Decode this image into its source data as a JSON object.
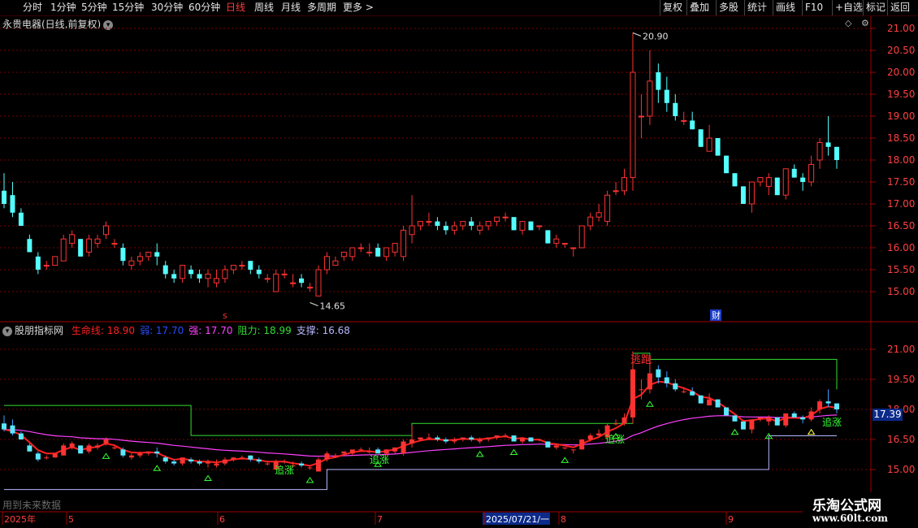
{
  "toolbar": {
    "left": [
      "分时",
      "1分钟",
      "5分钟",
      "15分钟",
      "30分钟",
      "60分钟",
      "日线",
      "周线",
      "月线",
      "多周期",
      "更多"
    ],
    "active_index": 6,
    "more_arrow": ">",
    "right": [
      "复权",
      "叠加",
      "多股",
      "统计",
      "画线",
      "F10",
      "+自选",
      "标记",
      "返回"
    ]
  },
  "stock": {
    "title": "永贵电器(日线,前复权)",
    "dropdown": "▾"
  },
  "corner": {
    "diamond": "◇",
    "gear": "⚙"
  },
  "indicator": {
    "name": "股朋指标网",
    "params": [
      {
        "label": "生命线: 18.90",
        "color": "#ff2020"
      },
      {
        "label": "弱: 17.70",
        "color": "#2a4bff"
      },
      {
        "label": "强: 17.70",
        "color": "#ff40ff"
      },
      {
        "label": "阻力: 18.99",
        "color": "#33dd33"
      },
      {
        "label": "支撑: 16.68",
        "color": "#b8b8ff"
      }
    ]
  },
  "axis": {
    "main_ticks": [
      "21.00",
      "20.50",
      "20.00",
      "19.50",
      "19.00",
      "18.50",
      "18.00",
      "17.50",
      "17.00",
      "16.50",
      "16.00",
      "15.50",
      "15.00"
    ],
    "ind_ticks": [
      "21.00",
      "19.50",
      "18.00",
      "16.50",
      "15.00"
    ]
  },
  "annotations": {
    "high": "20.90",
    "low": "14.65",
    "marker_s": "s",
    "marker_cai": "财",
    "signal_escape": "逃跑",
    "signal_chase": "追涨",
    "price_tag": "17.39"
  },
  "date_axis": {
    "labels": [
      "2025年",
      "5",
      "6",
      "7",
      "2025/07/21/一",
      "8",
      "9"
    ]
  },
  "bottom_note": "用到未来数据",
  "logo": {
    "line1": "乐淘公式网",
    "line2": "www.60lt.com"
  },
  "colors": {
    "up": "#ff3232",
    "down": "#54ffff",
    "bg": "#000000",
    "grid": "#7a0000"
  },
  "chart_data": {
    "type": "candlestick",
    "title": "永贵电器(日线,前复权)",
    "ylim": [
      14.6,
      21.1
    ],
    "high_label": 20.9,
    "low_label": 14.65,
    "last_close": 18.0,
    "ohlc": [
      [
        17.3,
        17.7,
        16.9,
        17.0
      ],
      [
        17.2,
        17.5,
        16.7,
        16.8
      ],
      [
        16.8,
        16.9,
        16.5,
        16.5
      ],
      [
        16.2,
        16.3,
        15.9,
        15.9
      ],
      [
        15.8,
        15.9,
        15.4,
        15.5
      ],
      [
        15.6,
        15.7,
        15.5,
        15.6
      ],
      [
        15.6,
        15.8,
        15.6,
        15.8
      ],
      [
        15.7,
        16.3,
        15.7,
        16.2
      ],
      [
        16.1,
        16.4,
        16.0,
        16.3
      ],
      [
        16.2,
        16.2,
        15.8,
        15.8
      ],
      [
        15.9,
        16.3,
        15.8,
        16.2
      ],
      [
        16.1,
        16.3,
        16.0,
        16.2
      ],
      [
        16.3,
        16.6,
        16.2,
        16.5
      ],
      [
        16.1,
        16.2,
        16.0,
        16.1
      ],
      [
        16.0,
        16.1,
        15.6,
        15.7
      ],
      [
        15.6,
        15.8,
        15.5,
        15.7
      ],
      [
        15.7,
        15.9,
        15.6,
        15.8
      ],
      [
        15.8,
        15.9,
        15.7,
        15.9
      ],
      [
        15.9,
        16.1,
        15.6,
        15.8
      ],
      [
        15.6,
        15.7,
        15.3,
        15.4
      ],
      [
        15.4,
        15.5,
        15.2,
        15.3
      ],
      [
        15.3,
        15.6,
        15.2,
        15.6
      ],
      [
        15.5,
        15.6,
        15.3,
        15.4
      ],
      [
        15.4,
        15.5,
        15.2,
        15.3
      ],
      [
        15.3,
        15.5,
        15.1,
        15.4
      ],
      [
        15.2,
        15.5,
        15.1,
        15.3
      ],
      [
        15.3,
        15.6,
        15.2,
        15.5
      ],
      [
        15.5,
        15.6,
        15.4,
        15.6
      ],
      [
        15.6,
        15.7,
        15.5,
        15.6
      ],
      [
        15.7,
        15.7,
        15.4,
        15.5
      ],
      [
        15.5,
        15.6,
        15.3,
        15.4
      ],
      [
        15.3,
        15.4,
        15.2,
        15.3
      ],
      [
        15.0,
        15.5,
        15.0,
        15.4
      ],
      [
        15.4,
        15.5,
        15.3,
        15.4
      ],
      [
        15.2,
        15.4,
        15.1,
        15.2
      ],
      [
        15.3,
        15.4,
        15.1,
        15.2
      ],
      [
        15.1,
        15.2,
        15.0,
        15.1
      ],
      [
        14.9,
        15.6,
        14.9,
        15.5
      ],
      [
        15.5,
        15.9,
        15.4,
        15.8
      ],
      [
        15.6,
        15.8,
        15.6,
        15.7
      ],
      [
        15.8,
        15.9,
        15.7,
        15.9
      ],
      [
        15.8,
        16.0,
        15.7,
        16.0
      ],
      [
        16.0,
        16.1,
        15.9,
        16.0
      ],
      [
        15.9,
        16.1,
        15.8,
        15.9
      ],
      [
        16.0,
        16.1,
        15.8,
        15.8
      ],
      [
        15.8,
        16.0,
        15.7,
        16.0
      ],
      [
        15.9,
        16.1,
        15.8,
        16.1
      ],
      [
        15.8,
        16.5,
        15.7,
        16.4
      ],
      [
        16.3,
        17.2,
        16.1,
        16.5
      ],
      [
        16.5,
        16.6,
        16.4,
        16.6
      ],
      [
        16.6,
        16.8,
        16.5,
        16.6
      ],
      [
        16.6,
        16.7,
        16.4,
        16.5
      ],
      [
        16.5,
        16.6,
        16.3,
        16.4
      ],
      [
        16.4,
        16.6,
        16.3,
        16.5
      ],
      [
        16.5,
        16.6,
        16.4,
        16.6
      ],
      [
        16.6,
        16.7,
        16.4,
        16.5
      ],
      [
        16.4,
        16.6,
        16.3,
        16.5
      ],
      [
        16.5,
        16.6,
        16.4,
        16.6
      ],
      [
        16.6,
        16.7,
        16.5,
        16.7
      ],
      [
        16.7,
        16.8,
        16.6,
        16.7
      ],
      [
        16.7,
        16.7,
        16.4,
        16.4
      ],
      [
        16.4,
        16.6,
        16.3,
        16.6
      ],
      [
        16.6,
        16.6,
        16.4,
        16.4
      ],
      [
        16.5,
        16.5,
        16.4,
        16.5
      ],
      [
        16.4,
        16.4,
        16.1,
        16.1
      ],
      [
        16.1,
        16.3,
        16.0,
        16.2
      ],
      [
        16.1,
        16.1,
        16.0,
        16.1
      ],
      [
        16.0,
        16.0,
        15.8,
        16.0
      ],
      [
        16.0,
        16.5,
        16.0,
        16.5
      ],
      [
        16.5,
        16.8,
        16.4,
        16.7
      ],
      [
        16.7,
        17.0,
        16.6,
        16.8
      ],
      [
        16.6,
        17.3,
        16.5,
        17.2
      ],
      [
        17.3,
        17.5,
        17.2,
        17.3
      ],
      [
        17.3,
        17.8,
        17.2,
        17.6
      ],
      [
        17.6,
        20.9,
        17.3,
        20.0
      ],
      [
        19.0,
        19.5,
        18.5,
        19.0
      ],
      [
        19.0,
        20.5,
        18.8,
        19.8
      ],
      [
        20.0,
        20.2,
        19.3,
        19.6
      ],
      [
        19.6,
        19.9,
        19.1,
        19.3
      ],
      [
        19.3,
        19.5,
        18.9,
        19.0
      ],
      [
        18.9,
        19.1,
        18.8,
        18.9
      ],
      [
        18.9,
        19.1,
        18.7,
        18.7
      ],
      [
        18.7,
        18.7,
        18.3,
        18.3
      ],
      [
        18.2,
        18.8,
        18.2,
        18.5
      ],
      [
        18.5,
        18.5,
        18.1,
        18.1
      ],
      [
        18.1,
        18.1,
        17.7,
        17.7
      ],
      [
        17.7,
        17.7,
        17.4,
        17.4
      ],
      [
        17.4,
        17.4,
        17.0,
        17.0
      ],
      [
        17.0,
        17.5,
        16.8,
        17.5
      ],
      [
        17.5,
        17.6,
        17.4,
        17.6
      ],
      [
        17.4,
        17.7,
        17.2,
        17.6
      ],
      [
        17.6,
        17.6,
        17.2,
        17.2
      ],
      [
        17.2,
        17.8,
        17.1,
        17.8
      ],
      [
        17.8,
        17.9,
        17.6,
        17.6
      ],
      [
        17.6,
        17.7,
        17.3,
        17.5
      ],
      [
        17.5,
        18.1,
        17.4,
        17.9
      ],
      [
        18.0,
        18.5,
        17.8,
        18.4
      ],
      [
        18.4,
        19.0,
        18.1,
        18.3
      ],
      [
        18.3,
        18.3,
        17.8,
        18.0
      ]
    ]
  }
}
